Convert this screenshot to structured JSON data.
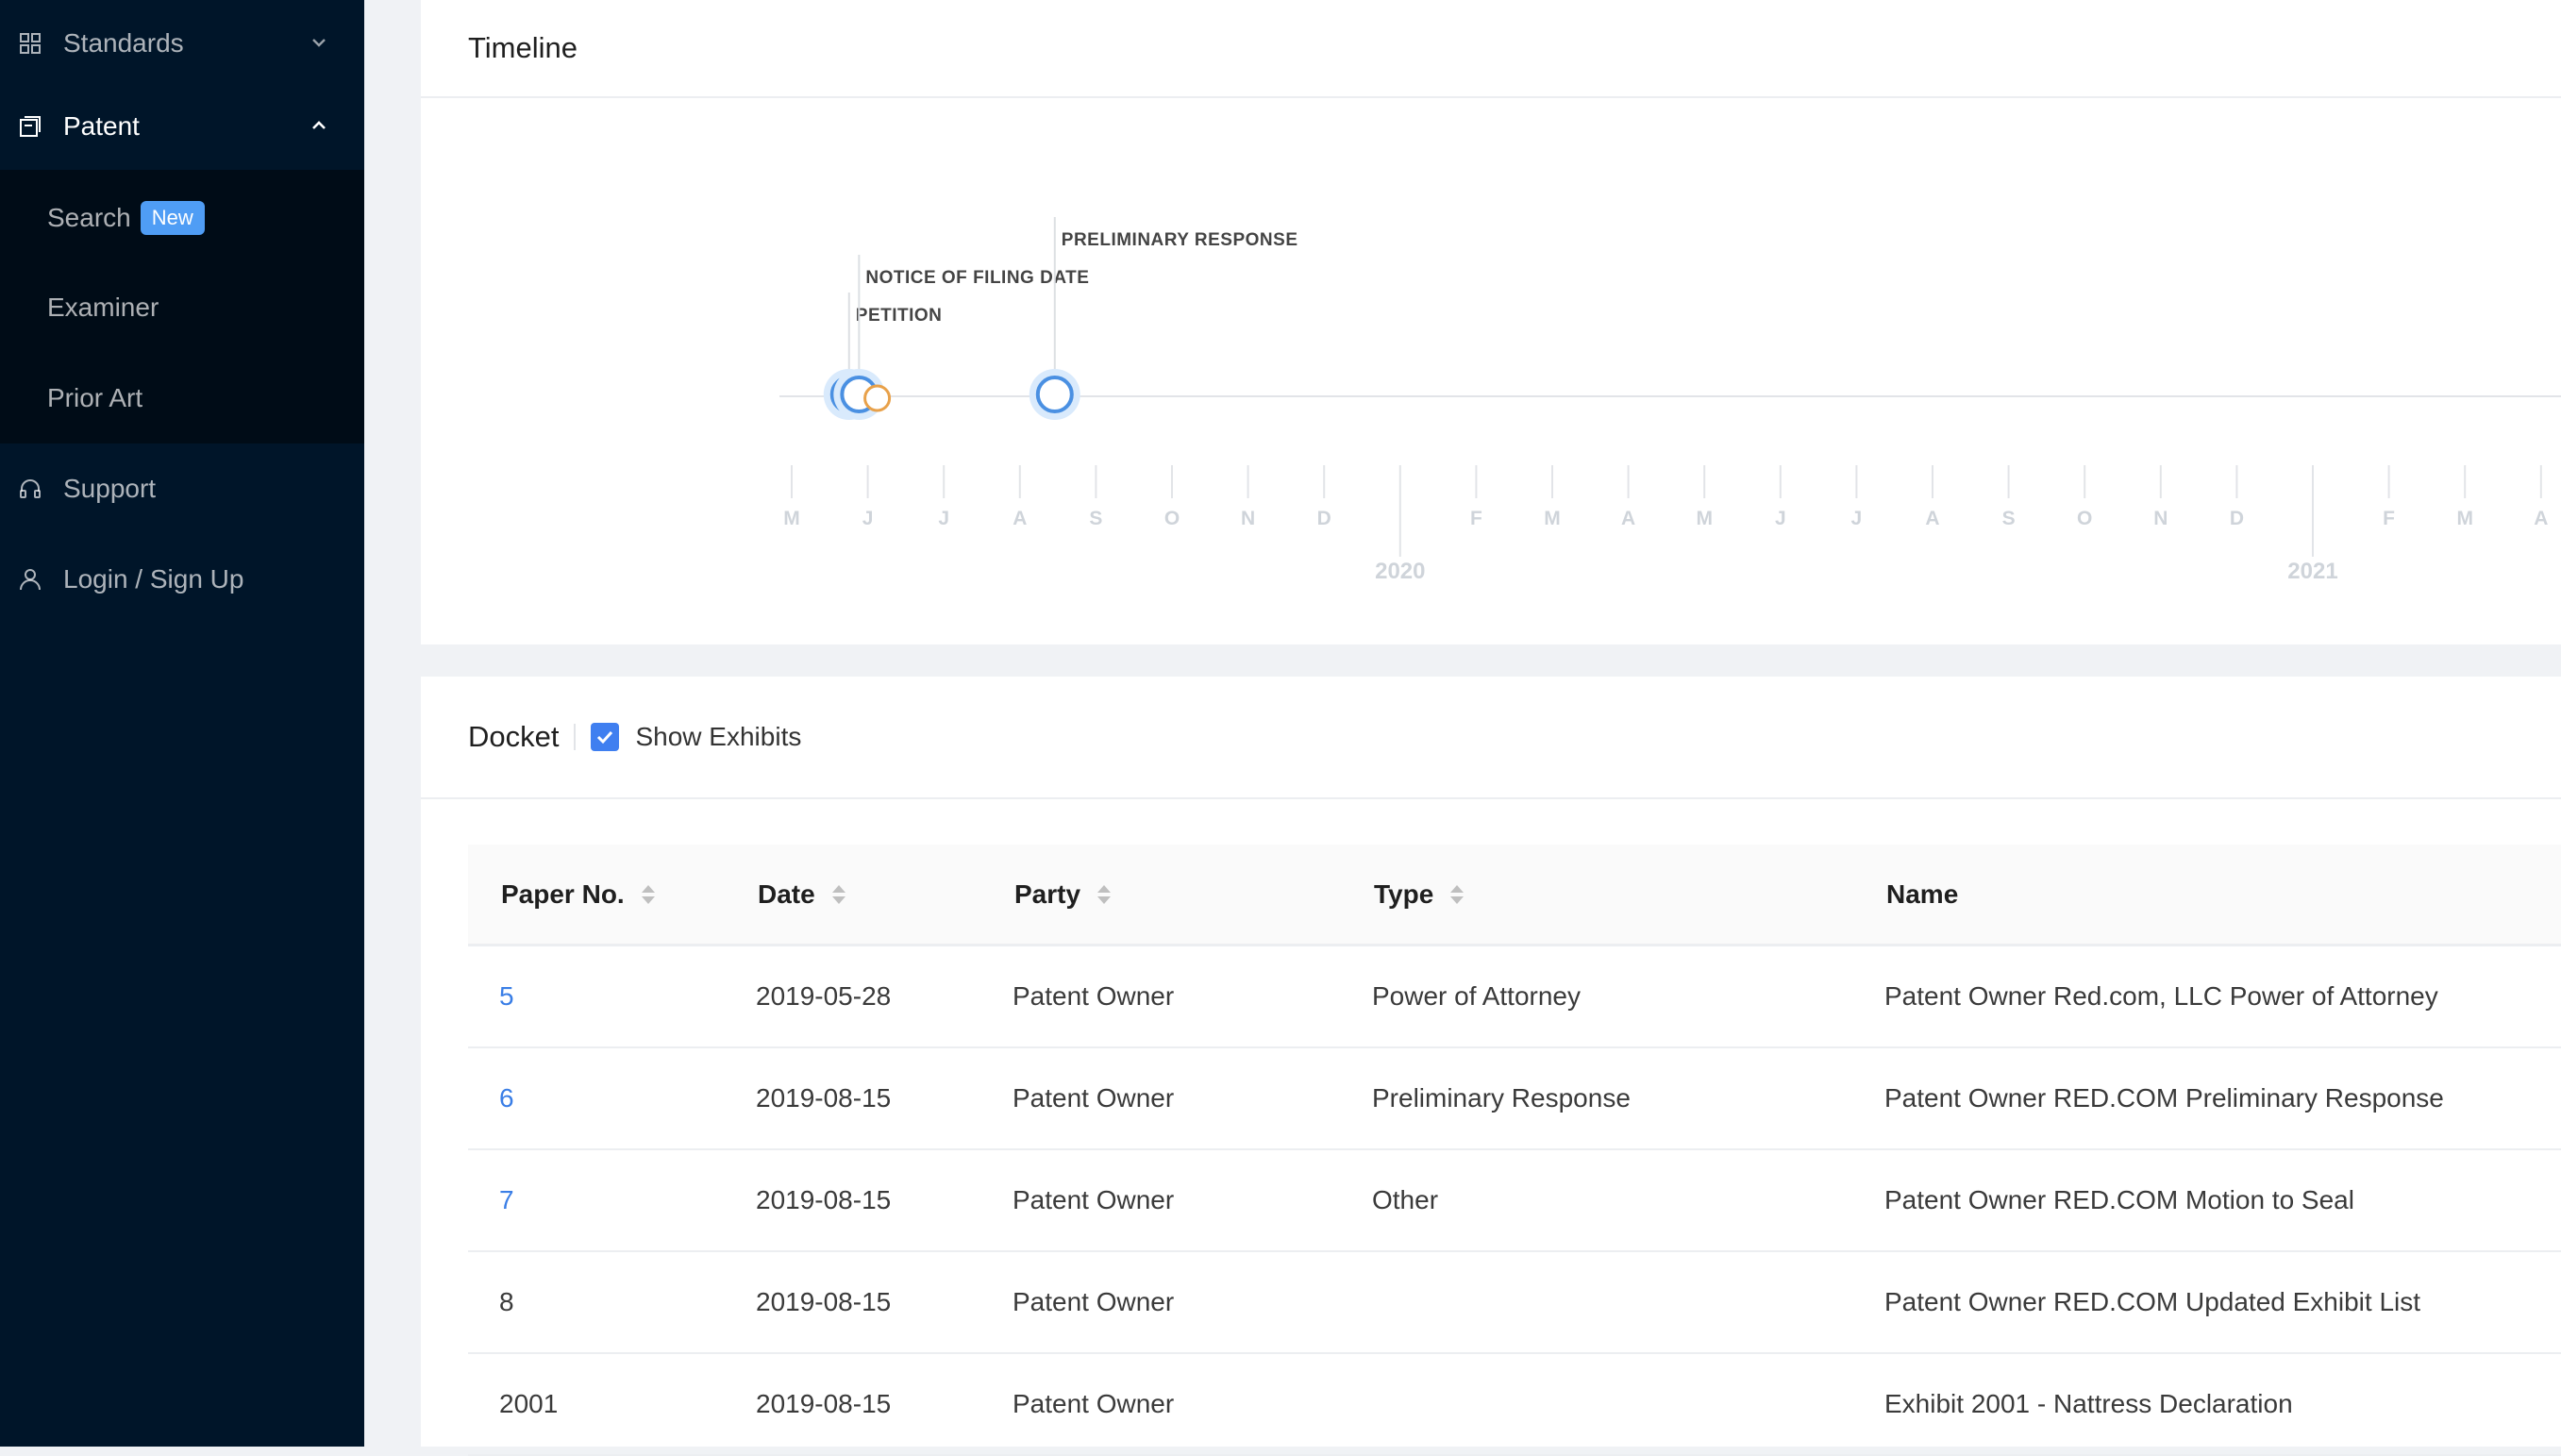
{
  "sidebar": {
    "items": [
      {
        "label": "Standards",
        "icon": "grid-icon",
        "arrow": "chevron-down-icon"
      },
      {
        "label": "Patent",
        "icon": "document-icon",
        "arrow": "chevron-up-icon"
      },
      {
        "label": "Support",
        "icon": "headset-icon"
      },
      {
        "label": "Login / Sign Up",
        "icon": "user-icon"
      }
    ],
    "submenu": [
      {
        "label": "Search",
        "badge": "New"
      },
      {
        "label": "Examiner"
      },
      {
        "label": "Prior Art"
      }
    ]
  },
  "timeline": {
    "title": "Timeline",
    "events": [
      {
        "label": "PETITION",
        "date": "2019-05-24",
        "color": "#4a90e2"
      },
      {
        "label": "NOTICE OF FILING DATE",
        "date": "2019-05-28",
        "color": "#4a90e2"
      },
      {
        "label": "",
        "date": "2019-06-01",
        "color": "#e8a14a"
      },
      {
        "label": "PRELIMINARY RESPONSE",
        "date": "2019-08-15",
        "color": "#4a90e2"
      }
    ],
    "month_ticks": [
      "M",
      "J",
      "J",
      "A",
      "S",
      "O",
      "N",
      "D",
      "",
      "F",
      "M",
      "A",
      "M",
      "J",
      "J",
      "A",
      "S",
      "O",
      "N",
      "D",
      "",
      "F",
      "M",
      "A"
    ],
    "year_ticks": [
      "2020",
      "2021"
    ]
  },
  "docket": {
    "title": "Docket",
    "show_exhibits_label": "Show Exhibits",
    "show_exhibits_checked": true,
    "columns": [
      "Paper No.",
      "Date",
      "Party",
      "Type",
      "Name"
    ],
    "rows": [
      {
        "paper": "5",
        "date": "2019-05-28",
        "party": "Patent Owner",
        "type": "Power of Attorney",
        "name": "Patent Owner Red.com, LLC Power of Attorney",
        "link": true
      },
      {
        "paper": "6",
        "date": "2019-08-15",
        "party": "Patent Owner",
        "type": "Preliminary Response",
        "name": "Patent Owner RED.COM Preliminary Response",
        "link": true
      },
      {
        "paper": "7",
        "date": "2019-08-15",
        "party": "Patent Owner",
        "type": "Other",
        "name": "Patent Owner RED.COM Motion to Seal",
        "link": true
      },
      {
        "paper": "8",
        "date": "2019-08-15",
        "party": "Patent Owner",
        "type": "",
        "name": "Patent Owner RED.COM Updated Exhibit List",
        "link": false
      },
      {
        "paper": "2001",
        "date": "2019-08-15",
        "party": "Patent Owner",
        "type": "",
        "name": "Exhibit 2001 - Nattress Declaration",
        "link": false
      }
    ]
  }
}
